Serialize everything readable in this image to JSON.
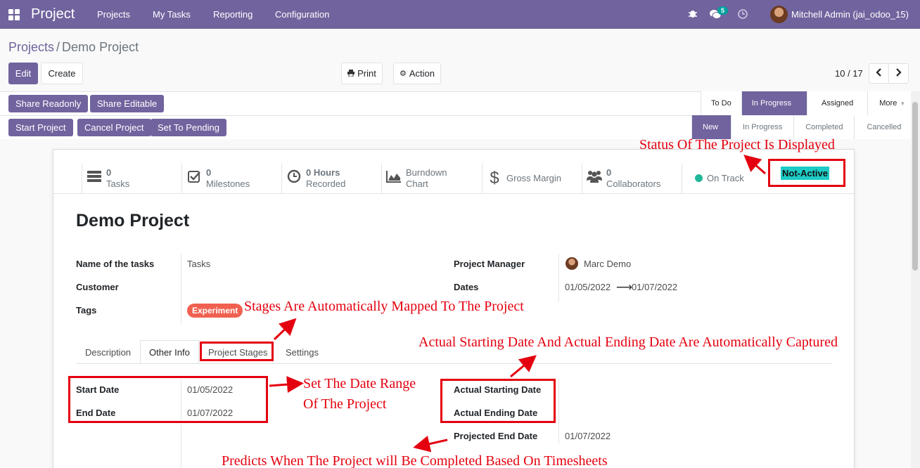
{
  "nav": {
    "app_name": "Project",
    "menu": [
      "Projects",
      "My Tasks",
      "Reporting",
      "Configuration"
    ],
    "chat_count": "5",
    "user": "Mitchell Admin (jai_odoo_15)"
  },
  "breadcrumb": {
    "parent": "Projects",
    "separator": "/",
    "current": "Demo Project"
  },
  "toolbar": {
    "edit": "Edit",
    "create": "Create",
    "print": "Print",
    "action": "Action",
    "pager": "10 / 17"
  },
  "buttons": {
    "share_readonly": "Share Readonly",
    "share_editable": "Share Editable",
    "start_project": "Start Project",
    "cancel_project": "Cancel Project",
    "set_to_pending": "Set To Pending"
  },
  "stages_top": [
    "To Do",
    "In Progress",
    "Assigned",
    "More"
  ],
  "stages_top_active": "In Progress",
  "stages_bottom": [
    "New",
    "In Progress",
    "Completed",
    "Cancelled"
  ],
  "stages_bottom_active": "New",
  "stat_buttons": {
    "tasks": {
      "num": "0",
      "label": "Tasks"
    },
    "milestones": {
      "num": "0",
      "label": "Milestones"
    },
    "hours": {
      "num": "0 Hours",
      "label": "Recorded"
    },
    "burndown": {
      "line1": "Burndown",
      "line2": "Chart"
    },
    "margin": {
      "label": "Gross Margin"
    },
    "collaborators": {
      "num": "0",
      "label": "Collaborators"
    },
    "track": {
      "label": "On Track"
    }
  },
  "status_badge": "Not-Active",
  "form": {
    "title": "Demo Project",
    "name_of_tasks_label": "Name of the tasks",
    "name_of_tasks": "Tasks",
    "customer_label": "Customer",
    "tags_label": "Tags",
    "tag": "Experiment",
    "manager_label": "Project Manager",
    "manager": "Marc Demo",
    "dates_label": "Dates",
    "date_start": "01/05/2022",
    "date_end": "01/07/2022"
  },
  "tabs": [
    "Description",
    "Other Info",
    "Project Stages",
    "Settings"
  ],
  "tabs_active": "Other Info",
  "other_info": {
    "start_date_label": "Start Date",
    "start_date": "01/05/2022",
    "end_date_label": "End Date",
    "end_date": "01/07/2022",
    "actual_start_label": "Actual Starting Date",
    "actual_end_label": "Actual Ending Date",
    "projected_end_label": "Projected End Date",
    "projected_end": "01/07/2022"
  },
  "annotations": {
    "status": "Status Of The Project Is Displayed",
    "stages": "Stages Are Automatically Mapped To The Project",
    "actual_dates": "Actual Starting Date And Actual Ending Date Are Automatically Captured",
    "date_range_1": "Set The Date Range",
    "date_range_2": "Of The Project",
    "predicts": "Predicts When The Project will Be Completed Based On Timesheets"
  },
  "colors": {
    "brand": "#71639e",
    "annotation": "#e4000f",
    "tag": "#f06050",
    "status_bg": "#1ecbc6",
    "on_track": "#21b799"
  }
}
